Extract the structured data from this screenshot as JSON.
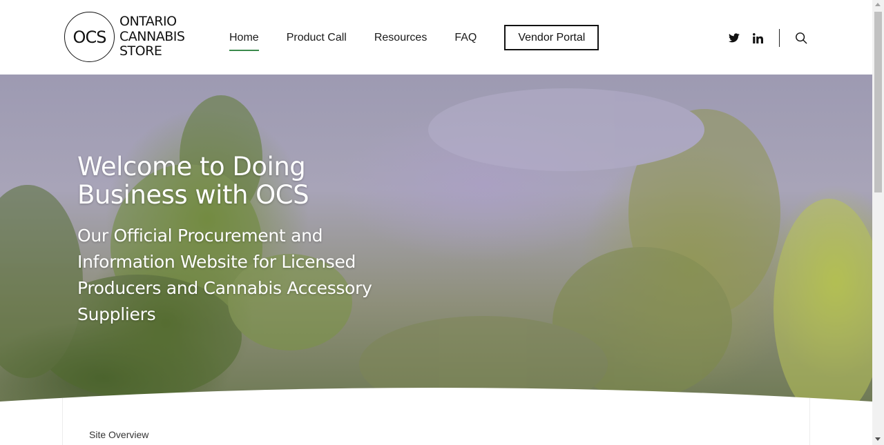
{
  "logo": {
    "monogram": "OCS",
    "line1": "ONTARIO",
    "line2": "CANNABIS",
    "line3": "STORE"
  },
  "nav": {
    "items": [
      {
        "label": "Home",
        "active": true
      },
      {
        "label": "Product Call",
        "active": false
      },
      {
        "label": "Resources",
        "active": false
      },
      {
        "label": "FAQ",
        "active": false
      }
    ],
    "vendor_portal": "Vendor Portal"
  },
  "social": {
    "icons": [
      "twitter-icon",
      "linkedin-icon",
      "search-icon"
    ]
  },
  "hero": {
    "title": "Welcome to Doing Business with OCS",
    "subtitle": "Our Official Procurement and Information Website for Licensed Producers and Cannabis Accessory Suppliers"
  },
  "content": {
    "section_label": "Site Overview"
  },
  "colors": {
    "accent": "#3a8a4c",
    "text": "#1a1a1a",
    "hero_text": "#ffffff"
  }
}
